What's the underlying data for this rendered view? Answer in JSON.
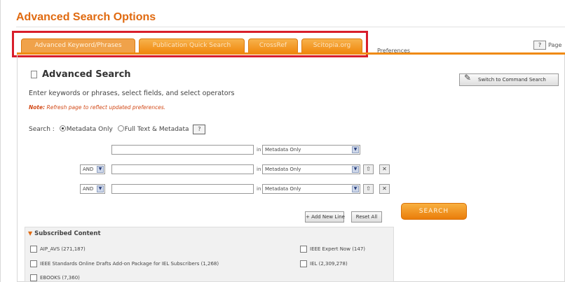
{
  "page": {
    "title": "Advanced Search Options"
  },
  "tabs": [
    {
      "label": "Advanced Keyword/Phrases",
      "active": true
    },
    {
      "label": "Publication Quick Search",
      "active": false
    },
    {
      "label": "CrossRef",
      "active": false
    },
    {
      "label": "Scitopia.org",
      "active": false
    }
  ],
  "preferences_label": "Preferences",
  "top_help": {
    "icon": "?",
    "label": "Page"
  },
  "advanced": {
    "title": "Advanced Search",
    "switch_label": "Switch to Command Search",
    "instructions": "Enter keywords or phrases, select fields, and select operators",
    "note_prefix": "Note:",
    "note_text": "Refresh page to reflect updated preferences."
  },
  "search_scope": {
    "label": "Search :",
    "options": [
      "Metadata Only",
      "Full Text & Metadata"
    ],
    "selected": "Metadata Only",
    "help": "?"
  },
  "rows": [
    {
      "operator": "",
      "keyword": "",
      "in": "in",
      "field": "Metadata Only"
    },
    {
      "operator": "AND",
      "keyword": "",
      "in": "in",
      "field": "Metadata Only"
    },
    {
      "operator": "AND",
      "keyword": "",
      "in": "in",
      "field": "Metadata Only"
    }
  ],
  "buttons": {
    "add_line": "Add New Line",
    "reset": "Reset All",
    "search": "SEARCH"
  },
  "subscribed": {
    "title": "Subscribed Content",
    "items": [
      "AIP_AVS (271,187)",
      "IEEE Expert Now (147)",
      "IEEE Standards Online Drafts Add-on Package for IEL Subscribers (1,268)",
      "IEL (2,309,278)",
      "EBOOKS (7,360)"
    ]
  },
  "colors": {
    "accent": "#f08a10",
    "highlight": "#d81e2b",
    "title": "#e06a10"
  }
}
